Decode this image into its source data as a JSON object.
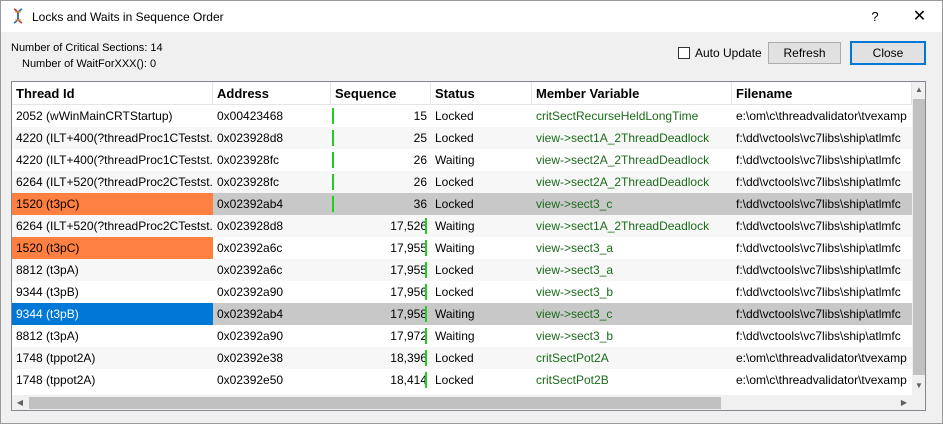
{
  "window": {
    "title": "Locks and Waits in Sequence Order",
    "help_label": "?",
    "close_glyph": "✕"
  },
  "info": {
    "critical_sections": "Number of Critical Sections:  14",
    "waitfor": "Number of WaitForXXX():  0"
  },
  "controls": {
    "auto_update_label": "Auto Update",
    "auto_update_checked": false,
    "refresh_label": "Refresh",
    "close_label": "Close"
  },
  "table": {
    "columns": [
      "Thread Id",
      "Address",
      "Sequence",
      "Status",
      "Member Variable",
      "Filename"
    ],
    "rows": [
      {
        "thread": "2052 (wWinMainCRTStartup)",
        "address": "0x00423468",
        "sequence": "15",
        "status": "Locked",
        "member": "critSectRecurseHeldLongTime",
        "file": "e:\\om\\c\\threadvalidator\\tvexamp",
        "highlight": "",
        "bar": true
      },
      {
        "thread": "4220 (ILT+400(?threadProc1CTestst...",
        "address": "0x023928d8",
        "sequence": "25",
        "status": "Locked",
        "member": "view->sect1A_2ThreadDeadlock",
        "file": "f:\\dd\\vctools\\vc7libs\\ship\\atlmfc",
        "highlight": "",
        "bar": true
      },
      {
        "thread": "4220 (ILT+400(?threadProc1CTestst...",
        "address": "0x023928fc",
        "sequence": "26",
        "status": "Waiting",
        "member": "view->sect2A_2ThreadDeadlock",
        "file": "f:\\dd\\vctools\\vc7libs\\ship\\atlmfc",
        "highlight": "",
        "bar": true
      },
      {
        "thread": "6264 (ILT+520(?threadProc2CTestst...",
        "address": "0x023928fc",
        "sequence": "26",
        "status": "Locked",
        "member": "view->sect2A_2ThreadDeadlock",
        "file": "f:\\dd\\vctools\\vc7libs\\ship\\atlmfc",
        "highlight": "",
        "bar": true
      },
      {
        "thread": "1520 (t3pC)",
        "address": "0x02392ab4",
        "sequence": "36",
        "status": "Locked",
        "member": "view->sect3_c",
        "file": "f:\\dd\\vctools\\vc7libs\\ship\\atlmfc",
        "highlight": "orange-gray",
        "bar": true
      },
      {
        "thread": "6264 (ILT+520(?threadProc2CTestst...",
        "address": "0x023928d8",
        "sequence": "17,526",
        "status": "Waiting",
        "member": "view->sect1A_2ThreadDeadlock",
        "file": "f:\\dd\\vctools\\vc7libs\\ship\\atlmfc",
        "highlight": "",
        "bar": true
      },
      {
        "thread": "1520 (t3pC)",
        "address": "0x02392a6c",
        "sequence": "17,955",
        "status": "Waiting",
        "member": "view->sect3_a",
        "file": "f:\\dd\\vctools\\vc7libs\\ship\\atlmfc",
        "highlight": "orange",
        "bar": true
      },
      {
        "thread": "8812 (t3pA)",
        "address": "0x02392a6c",
        "sequence": "17,955",
        "status": "Locked",
        "member": "view->sect3_a",
        "file": "f:\\dd\\vctools\\vc7libs\\ship\\atlmfc",
        "highlight": "",
        "bar": true
      },
      {
        "thread": "9344 (t3pB)",
        "address": "0x02392a90",
        "sequence": "17,956",
        "status": "Locked",
        "member": "view->sect3_b",
        "file": "f:\\dd\\vctools\\vc7libs\\ship\\atlmfc",
        "highlight": "",
        "bar": true
      },
      {
        "thread": "9344 (t3pB)",
        "address": "0x02392ab4",
        "sequence": "17,958",
        "status": "Waiting",
        "member": "view->sect3_c",
        "file": "f:\\dd\\vctools\\vc7libs\\ship\\atlmfc",
        "highlight": "blue-gray",
        "bar": true
      },
      {
        "thread": "8812 (t3pA)",
        "address": "0x02392a90",
        "sequence": "17,972",
        "status": "Waiting",
        "member": "view->sect3_b",
        "file": "f:\\dd\\vctools\\vc7libs\\ship\\atlmfc",
        "highlight": "",
        "bar": true
      },
      {
        "thread": "1748 (tppot2A)",
        "address": "0x02392e38",
        "sequence": "18,396",
        "status": "Locked",
        "member": "critSectPot2A",
        "file": "e:\\om\\c\\threadvalidator\\tvexamp",
        "highlight": "",
        "bar": true
      },
      {
        "thread": "1748 (tppot2A)",
        "address": "0x02392e50",
        "sequence": "18,414",
        "status": "Locked",
        "member": "critSectPot2B",
        "file": "e:\\om\\c\\threadvalidator\\tvexamp",
        "highlight": "",
        "bar": true
      }
    ]
  },
  "colors": {
    "orange": "#ff8040",
    "selected_blue": "#0078d7",
    "row_gray": "#c8c8c8",
    "alt_row": "#f7f7f7",
    "member_green": "#1a6b1a",
    "seq_bar": "#22cc22"
  },
  "icons": {
    "app": "dna-icon",
    "scroll_up": "▲",
    "scroll_down": "▼",
    "scroll_left": "◀",
    "scroll_right": "▶"
  }
}
